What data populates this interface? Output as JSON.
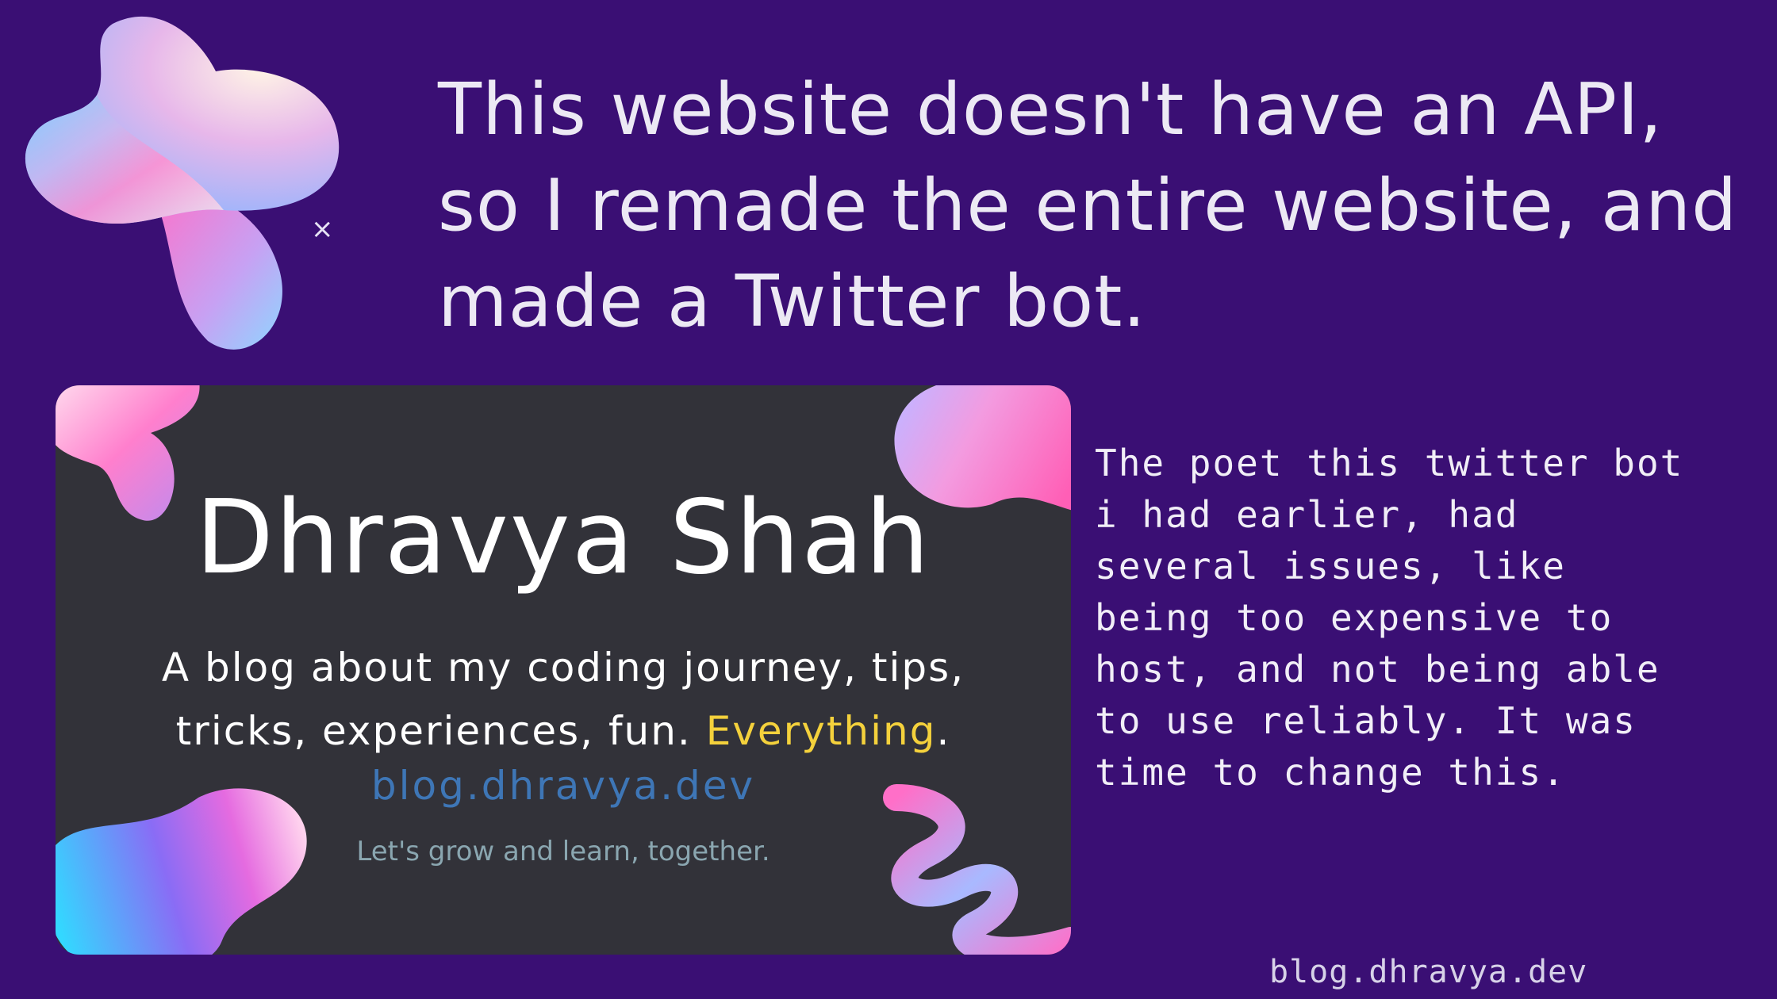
{
  "headline": {
    "lines": [
      "This website doesn't have an API,",
      "so I remade the entire website, and",
      "made a Twitter bot."
    ]
  },
  "card": {
    "title": "Dhravya Shah",
    "description_line1": "A blog about my coding journey, tips,",
    "description_line2_prefix": "tricks, experiences, fun. ",
    "description_highlight": "Everything",
    "description_line2_suffix": ".",
    "url": "blog.dhravya.dev",
    "tagline": "Let's grow and learn, together.",
    "highlight_color": "#f4d13c",
    "url_color": "#3e76b6"
  },
  "side_text": {
    "lines": [
      "The poet this twitter bot",
      "i had earlier, had",
      "several issues, like",
      "being too expensive to",
      "host, and not being able",
      "to use reliably. It was",
      "time to change this."
    ]
  },
  "footer": {
    "url": "blog.dhravya.dev"
  },
  "colors": {
    "background": "#3a0f74",
    "card_background": "#323239"
  }
}
